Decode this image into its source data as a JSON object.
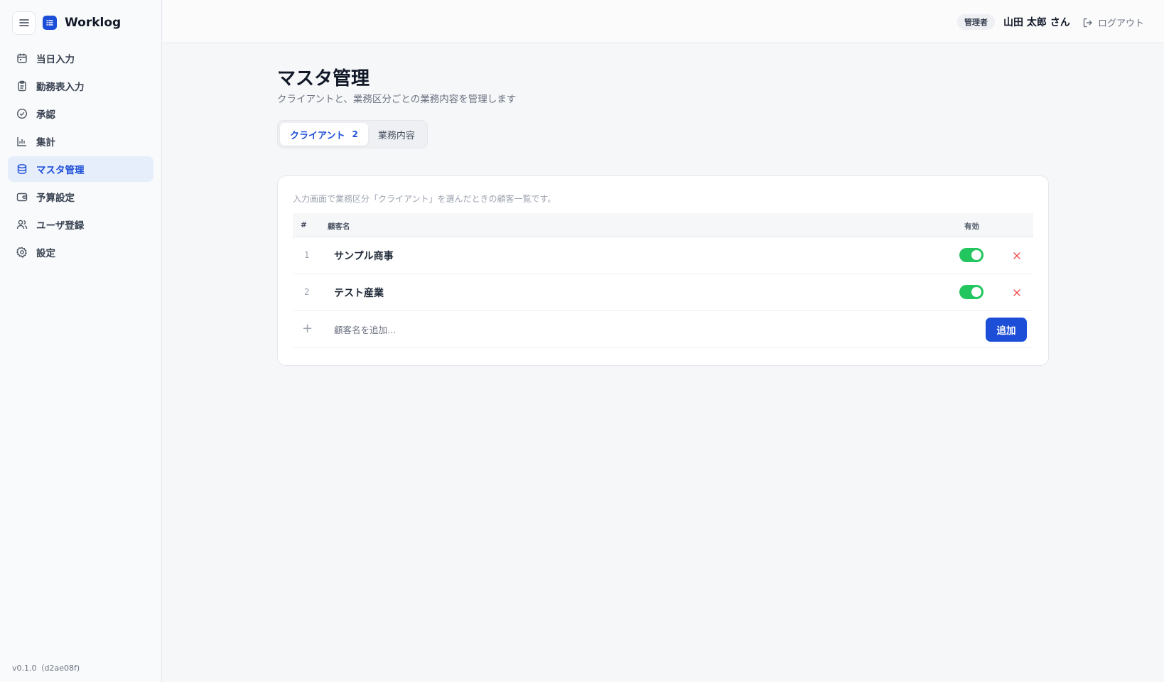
{
  "app": {
    "name": "Worklog",
    "version": "v0.1.0（d2ae08f)"
  },
  "sidebar": {
    "items": [
      {
        "label": "当日入力",
        "icon": "calendar-icon",
        "active": false
      },
      {
        "label": "勤務表入力",
        "icon": "clipboard-icon",
        "active": false
      },
      {
        "label": "承認",
        "icon": "check-circle-icon",
        "active": false
      },
      {
        "label": "集計",
        "icon": "bar-chart-icon",
        "active": false
      },
      {
        "label": "マスタ管理",
        "icon": "database-icon",
        "active": true
      },
      {
        "label": "予算設定",
        "icon": "wallet-icon",
        "active": false
      },
      {
        "label": "ユーザ登録",
        "icon": "users-icon",
        "active": false
      },
      {
        "label": "設定",
        "icon": "gear-icon",
        "active": false
      }
    ]
  },
  "header": {
    "role_badge": "管理者",
    "user_name": "山田 太郎 さん",
    "logout_label": "ログアウト"
  },
  "main": {
    "title": "マスタ管理",
    "subtitle": "クライアントと、業務区分ごとの業務内容を管理します",
    "tabs": [
      {
        "label": "クライアント",
        "count": "2",
        "active": true
      },
      {
        "label": "業務内容",
        "active": false
      }
    ],
    "card": {
      "note": "入力画面で業務区分「クライアント」を選んだときの顧客一覧です。",
      "columns": {
        "index": "#",
        "name": "顧客名",
        "enabled": "有効"
      },
      "rows": [
        {
          "index": "1",
          "name": "サンプル商事",
          "enabled": true
        },
        {
          "index": "2",
          "name": "テスト産業",
          "enabled": true
        }
      ],
      "add_row": {
        "placeholder": "顧客名を追加…",
        "button_label": "追加"
      }
    }
  },
  "colors": {
    "accent": "#1d4ed8",
    "toggle_on": "#22c55e",
    "delete": "#ef4444"
  }
}
